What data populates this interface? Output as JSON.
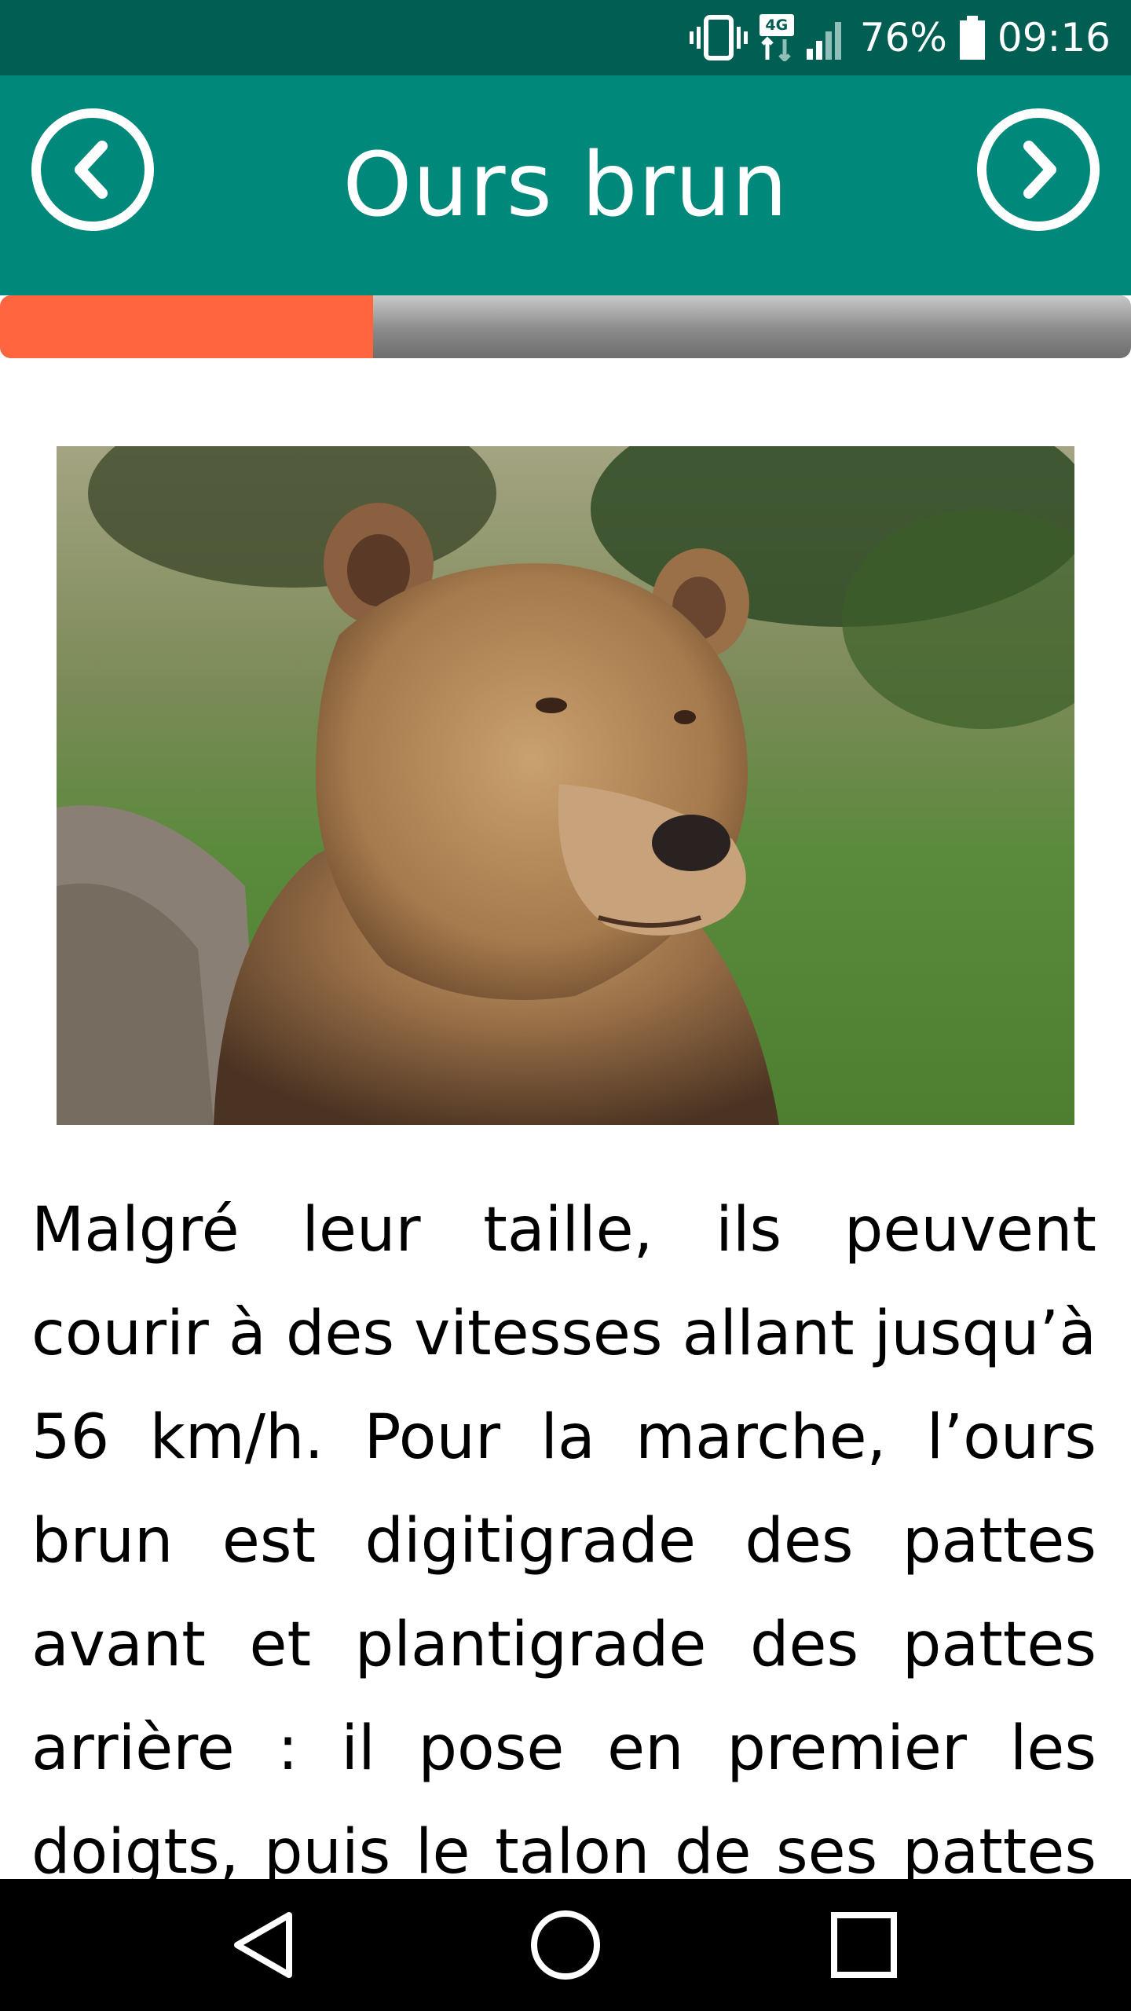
{
  "status_bar": {
    "network": "4G",
    "battery": "76%",
    "time": "09:16",
    "icons": [
      "vibrate-icon",
      "data-transfer-icon",
      "signal-icon",
      "battery-icon"
    ]
  },
  "header": {
    "title": "Ours brun",
    "prev_icon": "chevron-left-circle-icon",
    "next_icon": "chevron-right-circle-icon"
  },
  "progress": {
    "value": 0.33
  },
  "image": {
    "subject": "brown-bear-photo"
  },
  "content": {
    "text": "Malgré leur taille, ils peuvent courir à des vitesses allant jusqu’à 56 km/h. Pour la marche, l’ours brun est digitigrade des pattes avant et plantigrade des pattes arrière : il pose en premier les doigts, puis le talon de ses pattes antérieures."
  },
  "system_nav": {
    "icons": [
      "back-triangle-icon",
      "home-circle-icon",
      "recents-square-icon"
    ]
  },
  "colors": {
    "status_bar": "#005e52",
    "app_bar": "#00897b",
    "progress_fill": "#ff6640",
    "progress_track": "#8a8a8a"
  }
}
